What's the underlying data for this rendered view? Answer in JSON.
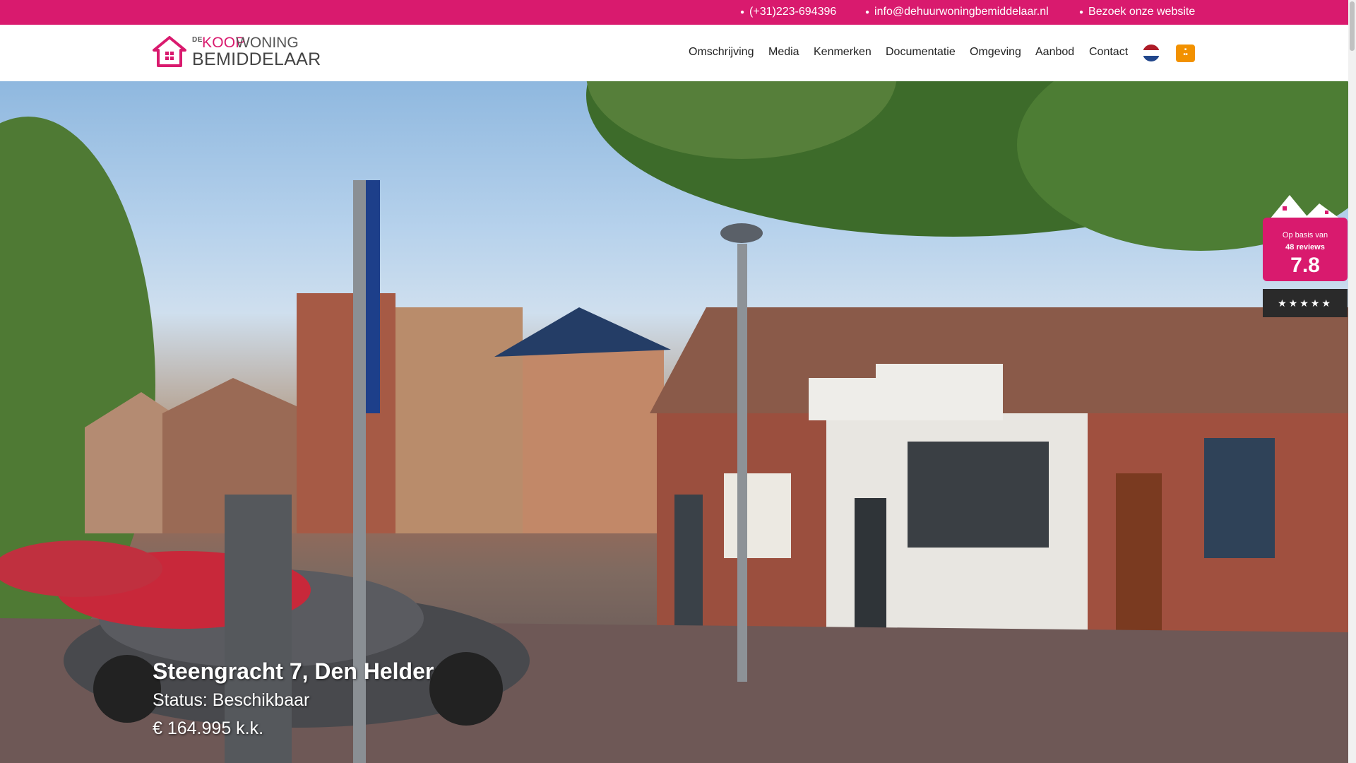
{
  "topbar": {
    "phone": "(+31)223-694396",
    "email": "info@dehuurwoningbemiddelaar.nl",
    "website": "Bezoek onze website"
  },
  "logo": {
    "de": "DE",
    "koop": "KOOP",
    "woning": "WONING",
    "bemiddelaar": "BEMIDDELAAR"
  },
  "nav": {
    "items": [
      {
        "label": "Omschrijving"
      },
      {
        "label": "Media"
      },
      {
        "label": "Kenmerken"
      },
      {
        "label": "Documentatie"
      },
      {
        "label": "Omgeving"
      },
      {
        "label": "Aanbod"
      },
      {
        "label": "Contact"
      }
    ]
  },
  "flag_icon": "netherlands-flag-icon",
  "hero": {
    "title": "Steengracht 7, Den Helder",
    "status": "Status: Beschikbaar",
    "price": "€ 164.995 k.k."
  },
  "review": {
    "prefix": "Op basis van",
    "count": "48 reviews",
    "score": "7.8",
    "stars": "★★★★★"
  },
  "colors": {
    "brand_pink": "#d91a6e",
    "badge_orange": "#f29100"
  }
}
